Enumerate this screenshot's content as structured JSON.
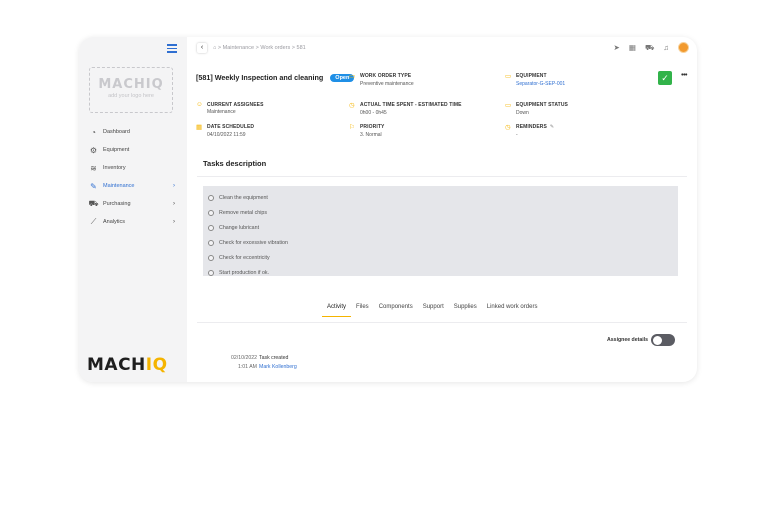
{
  "sidebar": {
    "logo_text": "MACHIQ",
    "logo_subtext": "add your logo here",
    "items": [
      {
        "label": "Dashboard",
        "icon": "dashboard-icon",
        "has_submenu": false
      },
      {
        "label": "Equipment",
        "icon": "equipment-icon",
        "has_submenu": false
      },
      {
        "label": "Inventory",
        "icon": "inventory-icon",
        "has_submenu": false
      },
      {
        "label": "Maintenance",
        "icon": "wrench-icon",
        "has_submenu": true,
        "active": true
      },
      {
        "label": "Purchasing",
        "icon": "cart-icon",
        "has_submenu": true
      },
      {
        "label": "Analytics",
        "icon": "chart-icon",
        "has_submenu": true
      }
    ],
    "brand_main": "MACH",
    "brand_accent": "IQ"
  },
  "topbar": {
    "back_glyph": "‹",
    "breadcrumb": [
      "Maintenance",
      "Work orders",
      "581"
    ],
    "separator": ">"
  },
  "header": {
    "title": "[581] Weekly Inspection and cleaning",
    "status": "Open",
    "work_order_type_label": "WORK ORDER TYPE",
    "work_order_type_value": "Preventive maintenance",
    "equipment_label": "EQUIPMENT",
    "equipment_value": "Separator-G-SEP-001",
    "current_assignees_label": "CURRENT ASSIGNEES",
    "current_assignees_value": "Maintenance",
    "time_label": "ACTUAL TIME SPENT - ESTIMATED TIME",
    "time_value": "0h00 - 0h45",
    "equipment_status_label": "EQUIPMENT STATUS",
    "equipment_status_value": "Down",
    "date_scheduled_label": "DATE SCHEDULED",
    "date_scheduled_value": "04/10/2022 11:59",
    "priority_label": "PRIORITY",
    "priority_value": "3. Normal",
    "reminders_label": "REMINDERS",
    "reminders_value": "-"
  },
  "tasks": {
    "title": "Tasks description",
    "items": [
      "Clean the equipment",
      "Remove metal chips",
      "Change lubricant",
      "Check for excessive vibration",
      "Check for eccentricity",
      "Start production if ok."
    ]
  },
  "tabs": [
    "Activity",
    "Files",
    "Components",
    "Support",
    "Supplies",
    "Linked work orders"
  ],
  "active_tab": "Activity",
  "assignee_details_label": "Assignee details",
  "activity": {
    "date": "02/10/2022",
    "text": "Task created",
    "time": "1:01 AM",
    "user": "Mark Kollenberg"
  },
  "colors": {
    "accent_blue": "#2f6fd1",
    "accent_yellow": "#f5b400",
    "status_badge": "#1f8fe6",
    "confirm_green": "#32b34a"
  }
}
